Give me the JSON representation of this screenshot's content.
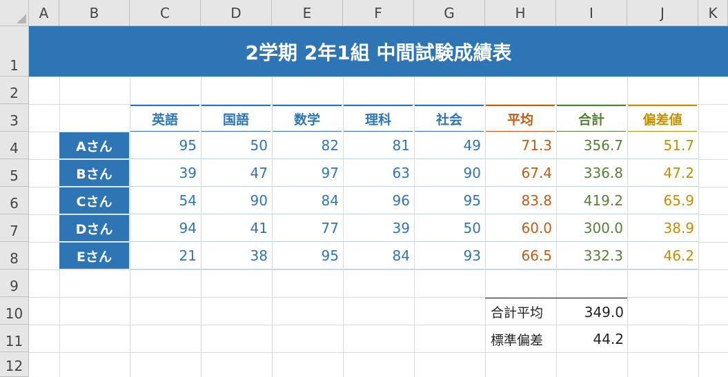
{
  "columns": [
    "A",
    "B",
    "C",
    "D",
    "E",
    "F",
    "G",
    "H",
    "I",
    "J",
    "K"
  ],
  "rows": [
    "1",
    "2",
    "3",
    "4",
    "5",
    "6",
    "7",
    "8",
    "9",
    "10",
    "11",
    "12"
  ],
  "title": "2学期 2年1組 中間試験成績表",
  "headers": {
    "subjects": [
      "英語",
      "国語",
      "数学",
      "理科",
      "社会"
    ],
    "average": "平均",
    "total": "合計",
    "deviation": "偏差値"
  },
  "students": [
    {
      "name": "Aさん",
      "scores": [
        "95",
        "50",
        "82",
        "81",
        "49"
      ],
      "average": "71.3",
      "total": "356.7",
      "deviation": "51.7"
    },
    {
      "name": "Bさん",
      "scores": [
        "39",
        "47",
        "97",
        "63",
        "90"
      ],
      "average": "67.4",
      "total": "336.8",
      "deviation": "47.2"
    },
    {
      "name": "Cさん",
      "scores": [
        "54",
        "90",
        "84",
        "96",
        "95"
      ],
      "average": "83.8",
      "total": "419.2",
      "deviation": "65.9"
    },
    {
      "name": "Dさん",
      "scores": [
        "94",
        "41",
        "77",
        "39",
        "50"
      ],
      "average": "60.0",
      "total": "300.0",
      "deviation": "38.9"
    },
    {
      "name": "Eさん",
      "scores": [
        "21",
        "38",
        "95",
        "84",
        "93"
      ],
      "average": "66.5",
      "total": "332.3",
      "deviation": "46.2"
    }
  ],
  "summary": {
    "total_avg_label": "合計平均",
    "total_avg_value": "349.0",
    "std_dev_label": "標準偏差",
    "std_dev_value": "44.2"
  },
  "colors": {
    "blue": "#2e75b6",
    "orange": "#c55a11",
    "green": "#548235",
    "gold": "#bf9000"
  }
}
